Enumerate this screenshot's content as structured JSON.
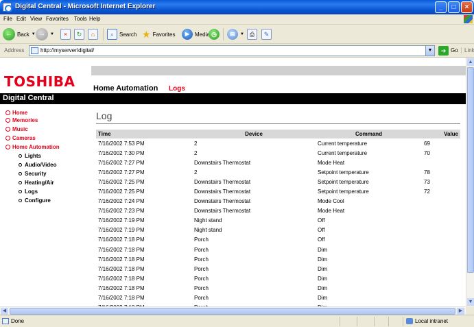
{
  "window": {
    "title": "Digital Central - Microsoft Internet Explorer",
    "min_glyph": "_",
    "max_glyph": "□",
    "close_glyph": "×"
  },
  "menu": [
    "File",
    "Edit",
    "View",
    "Favorites",
    "Tools",
    "Help"
  ],
  "toolbar": {
    "back": "Back",
    "search": "Search",
    "favorites": "Favorites",
    "media": "Media"
  },
  "address": {
    "label": "Address",
    "url": "http://myserver/digital/",
    "go": "Go",
    "links": "Links"
  },
  "page": {
    "brand": "TOSHIBA",
    "app_name": "Digital Central",
    "section": "Home Automation",
    "subsection": "Logs",
    "heading": "Log"
  },
  "nav": {
    "main": [
      "Home",
      "Memories",
      "Music",
      "Cameras",
      "Home Automation"
    ],
    "sub": [
      "Lights",
      "Audio/Video",
      "Security",
      "Heating/Air",
      "Logs",
      "Configure"
    ]
  },
  "log": {
    "columns": [
      "Time",
      "Device",
      "Command",
      "Value"
    ],
    "rows": [
      [
        "7/16/2002 7:53 PM",
        "2",
        "Current temperature",
        "69"
      ],
      [
        "7/16/2002 7:30 PM",
        "2",
        "Current temperature",
        "70"
      ],
      [
        "7/16/2002 7:27 PM",
        "Downstairs Thermostat",
        "Mode Heat",
        ""
      ],
      [
        "7/16/2002 7:27 PM",
        "2",
        "Setpoint temperature",
        "78"
      ],
      [
        "7/16/2002 7:25 PM",
        "Downstairs Thermostat",
        "Setpoint temperature",
        "73"
      ],
      [
        "7/16/2002 7:25 PM",
        "Downstairs Thermostat",
        "Setpoint temperature",
        "72"
      ],
      [
        "7/16/2002 7:24 PM",
        "Downstairs Thermostat",
        "Mode Cool",
        ""
      ],
      [
        "7/16/2002 7:23 PM",
        "Downstairs Thermostat",
        "Mode Heat",
        ""
      ],
      [
        "7/16/2002 7:19 PM",
        "Night stand",
        "Off",
        ""
      ],
      [
        "7/16/2002 7:19 PM",
        "Night stand",
        "Off",
        ""
      ],
      [
        "7/16/2002 7:18 PM",
        "Porch",
        "Off",
        ""
      ],
      [
        "7/16/2002 7:18 PM",
        "Porch",
        "Dim",
        ""
      ],
      [
        "7/16/2002 7:18 PM",
        "Porch",
        "Dim",
        ""
      ],
      [
        "7/16/2002 7:18 PM",
        "Porch",
        "Dim",
        ""
      ],
      [
        "7/16/2002 7:18 PM",
        "Porch",
        "Dim",
        ""
      ],
      [
        "7/16/2002 7:18 PM",
        "Porch",
        "Dim",
        ""
      ],
      [
        "7/16/2002 7:18 PM",
        "Porch",
        "Dim",
        ""
      ],
      [
        "7/16/2002 7:18 PM",
        "Porch",
        "Dim",
        ""
      ]
    ]
  },
  "status": {
    "text": "Done",
    "zone": "Local intranet"
  },
  "colors": {
    "brand_red": "#e2001a",
    "xp_blue": "#0a55d0"
  }
}
